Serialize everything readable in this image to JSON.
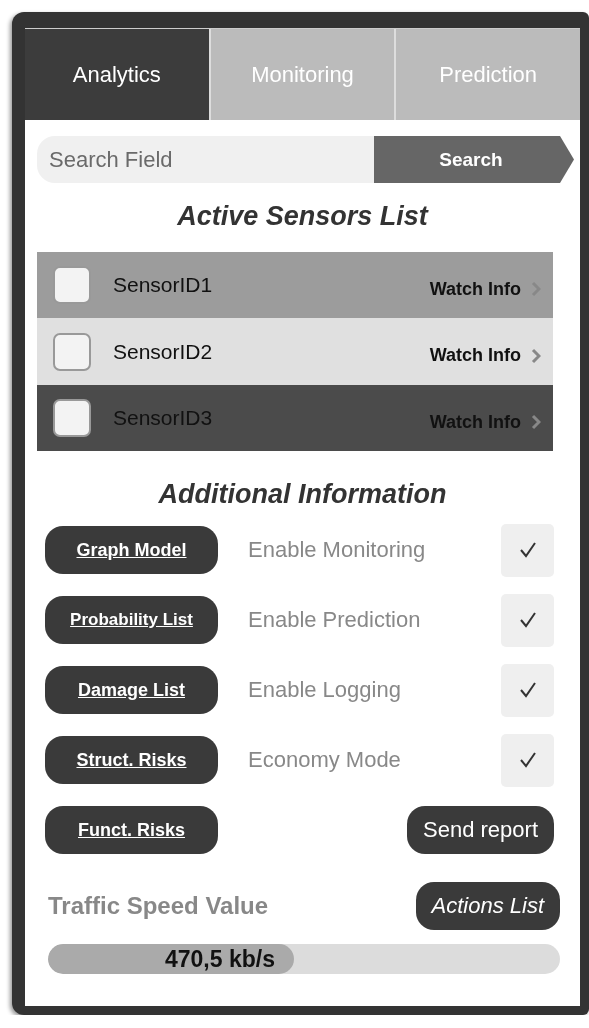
{
  "tabs": [
    {
      "label": "Analytics",
      "selected": true
    },
    {
      "label": "Monitoring",
      "selected": false
    },
    {
      "label": "Prediction",
      "selected": false
    }
  ],
  "search": {
    "placeholder": "Search Field",
    "button": "Search"
  },
  "sensors_title": "Active Sensors List",
  "sensors": [
    {
      "name": "SensorID1",
      "checked": false,
      "color": "#9c9c9c",
      "link": "Watch Info"
    },
    {
      "name": "SensorID2",
      "checked": false,
      "color": "#e0e0e0",
      "link": "Watch Info"
    },
    {
      "name": "SensorID3",
      "checked": false,
      "color": "#4b4b4b",
      "link": "Watch Info"
    }
  ],
  "info_title": "Additional Information",
  "options": [
    {
      "button": "Graph Model",
      "label": "Enable Monitoring",
      "checked": true
    },
    {
      "button": "Probability List",
      "label": "Enable Prediction",
      "checked": true
    },
    {
      "button": "Damage List",
      "label": "Enable Logging",
      "checked": true
    },
    {
      "button": "Struct. Risks",
      "label": "Economy Mode",
      "checked": true
    },
    {
      "button": "Funct. Risks"
    }
  ],
  "send_button": "Send report",
  "traffic": {
    "label": "Traffic Speed Value",
    "actions_button": "Actions List",
    "level": 0.48,
    "reading": "470,5 kb/s"
  }
}
